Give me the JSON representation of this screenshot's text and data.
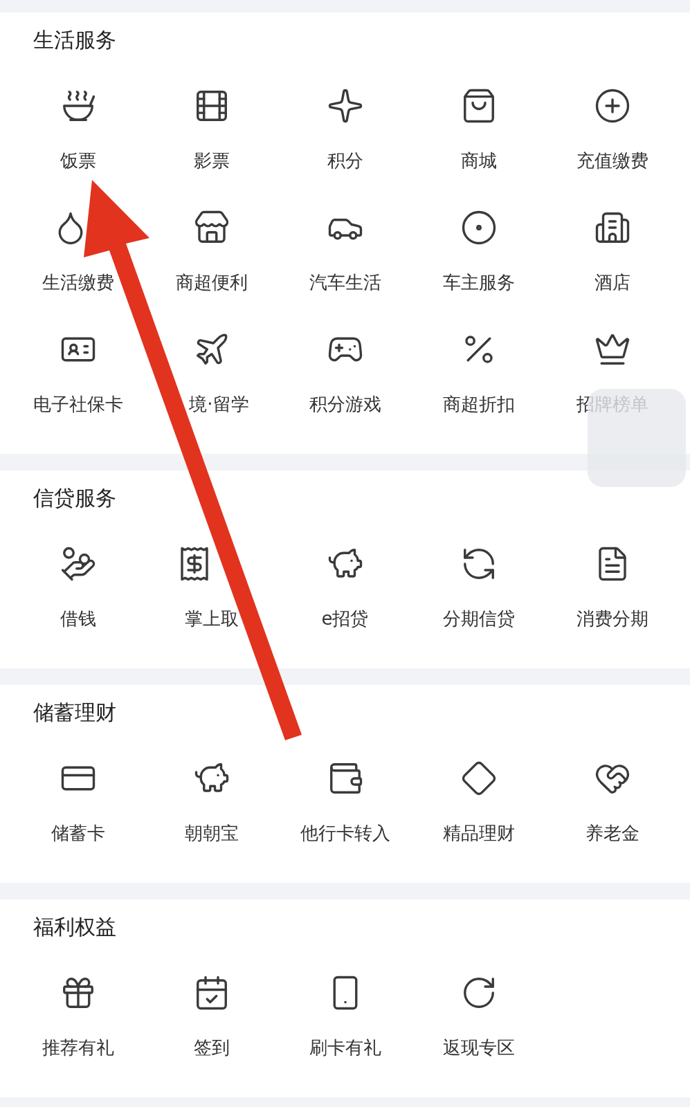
{
  "sections": [
    {
      "title": "生活服务",
      "items": [
        {
          "label": "饭票"
        },
        {
          "label": "影票"
        },
        {
          "label": "积分"
        },
        {
          "label": "商城"
        },
        {
          "label": "充值缴费"
        },
        {
          "label": "生活缴费"
        },
        {
          "label": "商超便利"
        },
        {
          "label": "汽车生活"
        },
        {
          "label": "车主服务"
        },
        {
          "label": "酒店"
        },
        {
          "label": "电子社保卡"
        },
        {
          "label": "境·留学"
        },
        {
          "label": "积分游戏"
        },
        {
          "label": "商超折扣"
        },
        {
          "label": "招牌榜单"
        }
      ]
    },
    {
      "title": "信贷服务",
      "items": [
        {
          "label": "借钱"
        },
        {
          "label": "掌上取"
        },
        {
          "label": "e招贷"
        },
        {
          "label": "分期信贷"
        },
        {
          "label": "消费分期"
        }
      ]
    },
    {
      "title": "储蓄理财",
      "items": [
        {
          "label": "储蓄卡"
        },
        {
          "label": "朝朝宝"
        },
        {
          "label": "他行卡转入"
        },
        {
          "label": "精品理财"
        },
        {
          "label": "养老金"
        }
      ]
    },
    {
      "title": "福利权益",
      "items": [
        {
          "label": "推荐有礼"
        },
        {
          "label": "签到"
        },
        {
          "label": "刷卡有礼"
        },
        {
          "label": "返现专区"
        }
      ]
    }
  ]
}
